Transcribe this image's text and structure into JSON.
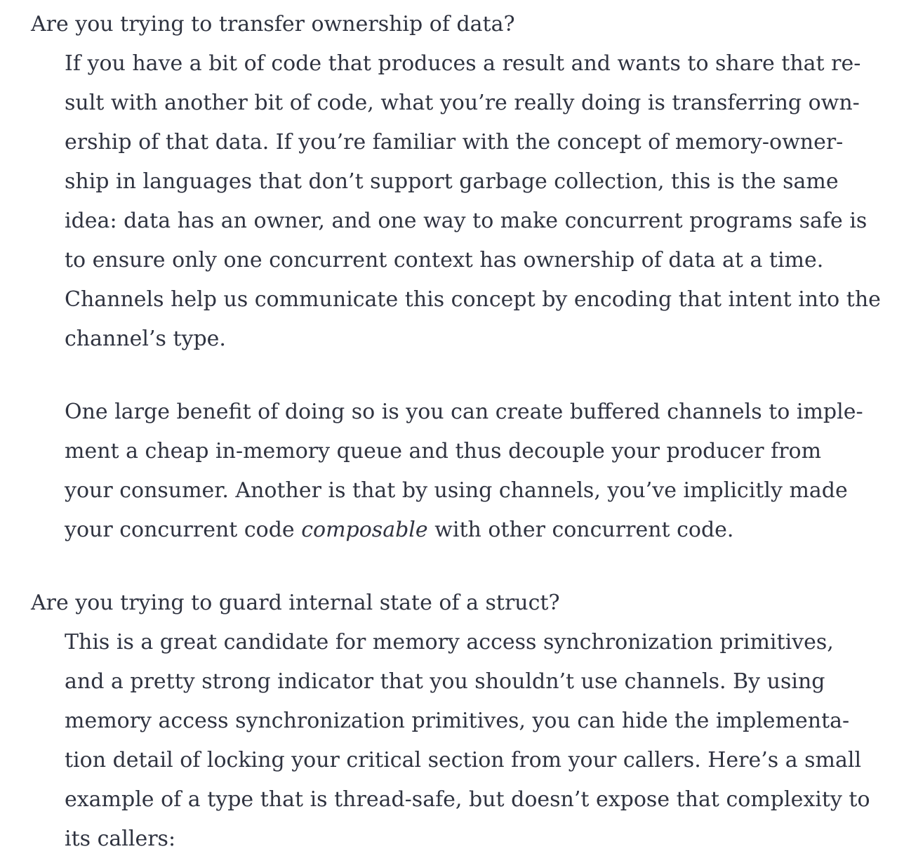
{
  "section1": {
    "term": "Are you trying to transfer ownership of data?",
    "para1_lines": [
      "If you have a bit of code that produces a result and wants to share that re-",
      "sult with another bit of code, what you’re really doing is transferring own-",
      "ership of that data. If you’re familiar with the concept of memory-owner-",
      "ship in languages that don’t support garbage collection, this is the same",
      "idea: data has an owner, and one way to make concurrent programs safe is",
      "to ensure only one concurrent context has ownership of data at a time.",
      "Channels help us communicate this concept by encoding that intent into the",
      "channel’s type."
    ],
    "para2_lines": [
      "One large benefit of doing so is you can create buffered channels to imple-",
      "ment a cheap in-memory queue and thus decouple your producer from",
      "your consumer. Another is that by using channels, you’ve implicitly made"
    ],
    "para2_last": {
      "before": "your concurrent code ",
      "emphasis": "composable",
      "after": " with other concurrent code."
    }
  },
  "section2": {
    "term": "Are you trying to guard internal state of a struct?",
    "para_lines": [
      "This is a great candidate for memory access synchronization primitives,",
      "and a pretty strong indicator that you shouldn’t use channels. By using",
      "memory access synchronization primitives, you can hide the implementa-",
      "tion detail of locking your critical section from your callers. Here’s a small",
      "example of a type that is thread-safe, but doesn’t expose that complexity to",
      "its callers:"
    ]
  }
}
